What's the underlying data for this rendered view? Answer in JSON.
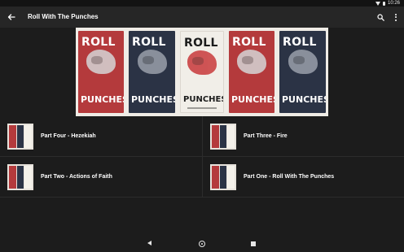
{
  "status_bar": {
    "time": "10:26",
    "icons": [
      "wifi-icon",
      "battery-icon"
    ]
  },
  "app_bar": {
    "title": "Roll With The Punches",
    "back_icon": "arrow-left-icon",
    "search_icon": "search-icon",
    "more_icon": "more-vertical-icon"
  },
  "banner": {
    "posters": [
      {
        "style": "red",
        "top": "ROLL",
        "bottom": "PUNCHES"
      },
      {
        "style": "navy",
        "top": "ROLL",
        "bottom": "PUNCHES"
      },
      {
        "style": "cream",
        "top": "ROLL",
        "bottom": "PUNCHES"
      },
      {
        "style": "red",
        "top": "ROLL",
        "bottom": "PUNCHES"
      },
      {
        "style": "navy",
        "top": "ROLL",
        "bottom": "PUNCHES"
      }
    ]
  },
  "episodes": [
    {
      "label": "Part Four - Hezekiah"
    },
    {
      "label": "Part Three - Fire"
    },
    {
      "label": "Part Two - Actions of Faith"
    },
    {
      "label": "Part One - Roll With The Punches"
    }
  ],
  "nav_bar": {
    "back_icon": "nav-back-icon",
    "home_icon": "nav-home-icon",
    "recents_icon": "nav-recents-icon"
  },
  "colors": {
    "background": "#1c1c1c",
    "app_bar": "#262626",
    "poster_red": "#b43a3c",
    "poster_navy": "#2b3345",
    "poster_cream": "#f1eee8"
  }
}
